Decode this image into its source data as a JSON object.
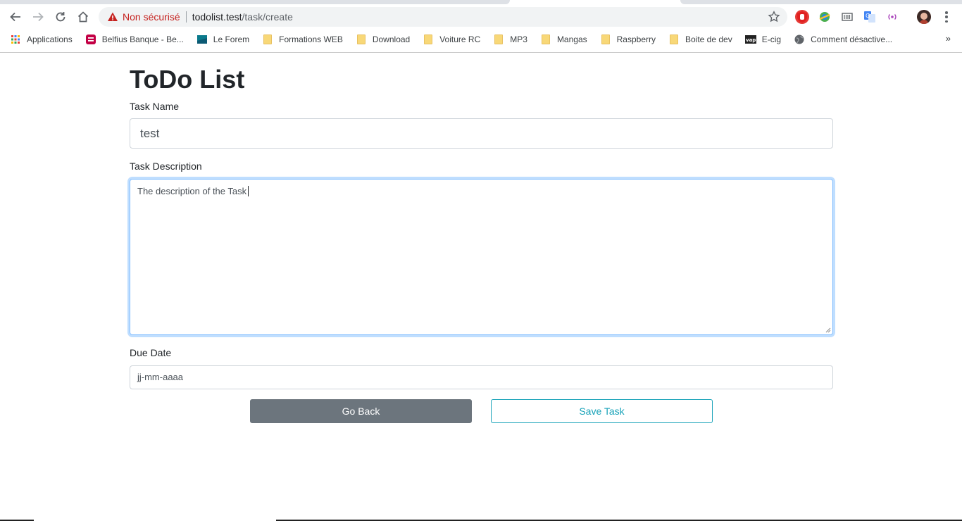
{
  "browser": {
    "security_label": "Non sécurisé",
    "url_host": "todolist.test",
    "url_path": "/task/create",
    "bookmarks": [
      {
        "label": "Applications",
        "icon": "apps-grid-icon"
      },
      {
        "label": "Belfius Banque - Be...",
        "icon": "belfius-icon"
      },
      {
        "label": "Le Forem",
        "icon": "forem-icon"
      },
      {
        "label": "Formations WEB",
        "icon": "folder-icon"
      },
      {
        "label": "Download",
        "icon": "folder-icon"
      },
      {
        "label": "Voiture RC",
        "icon": "folder-icon"
      },
      {
        "label": "MP3",
        "icon": "folder-icon"
      },
      {
        "label": "Mangas",
        "icon": "folder-icon"
      },
      {
        "label": "Raspberry",
        "icon": "folder-icon"
      },
      {
        "label": "Boite de dev",
        "icon": "folder-icon"
      },
      {
        "label": "E-cig",
        "icon": "vap-icon"
      },
      {
        "label": "Comment désactive...",
        "icon": "globe-icon"
      }
    ],
    "more_bookmarks": "»"
  },
  "page": {
    "title": "ToDo List",
    "task_name_label": "Task Name",
    "task_name_value": "test",
    "task_description_label": "Task Description",
    "task_description_value": "The description of the Task",
    "due_date_label": "Due Date",
    "due_date_placeholder": "jj-mm-aaaa",
    "go_back_label": "Go Back",
    "save_task_label": "Save Task"
  },
  "colors": {
    "secondary": "#6c757d",
    "info": "#17a2b8",
    "focus_border": "#80bdff",
    "insecure": "#c5221f"
  }
}
